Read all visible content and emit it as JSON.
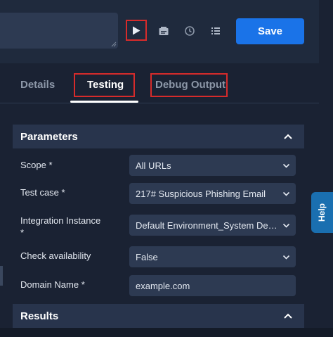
{
  "toolbar": {
    "save_label": "Save",
    "icons": [
      "play-icon",
      "document-icon",
      "history-icon",
      "list-icon"
    ]
  },
  "tabs": [
    {
      "label": "Details",
      "active": false
    },
    {
      "label": "Testing",
      "active": true
    },
    {
      "label": "Debug Output",
      "active": false
    }
  ],
  "parameters": {
    "title": "Parameters",
    "fields": [
      {
        "label": "Scope *",
        "value": "All URLs",
        "type": "select"
      },
      {
        "label": "Test case *",
        "value": "217# Suspicious Phishing Email",
        "type": "select"
      },
      {
        "label": "Integration Instance *",
        "value": "Default Environment_System Defa...",
        "type": "select"
      },
      {
        "label": "Check availability",
        "value": "False",
        "type": "select"
      },
      {
        "label": "Domain Name *",
        "value": "example.com",
        "type": "input"
      }
    ]
  },
  "results": {
    "title": "Results"
  },
  "help": {
    "label": "Help"
  },
  "colors": {
    "accent": "#1a73e8",
    "highlight": "#d62b2b",
    "background": "#1a2233",
    "panel": "#28344c"
  }
}
